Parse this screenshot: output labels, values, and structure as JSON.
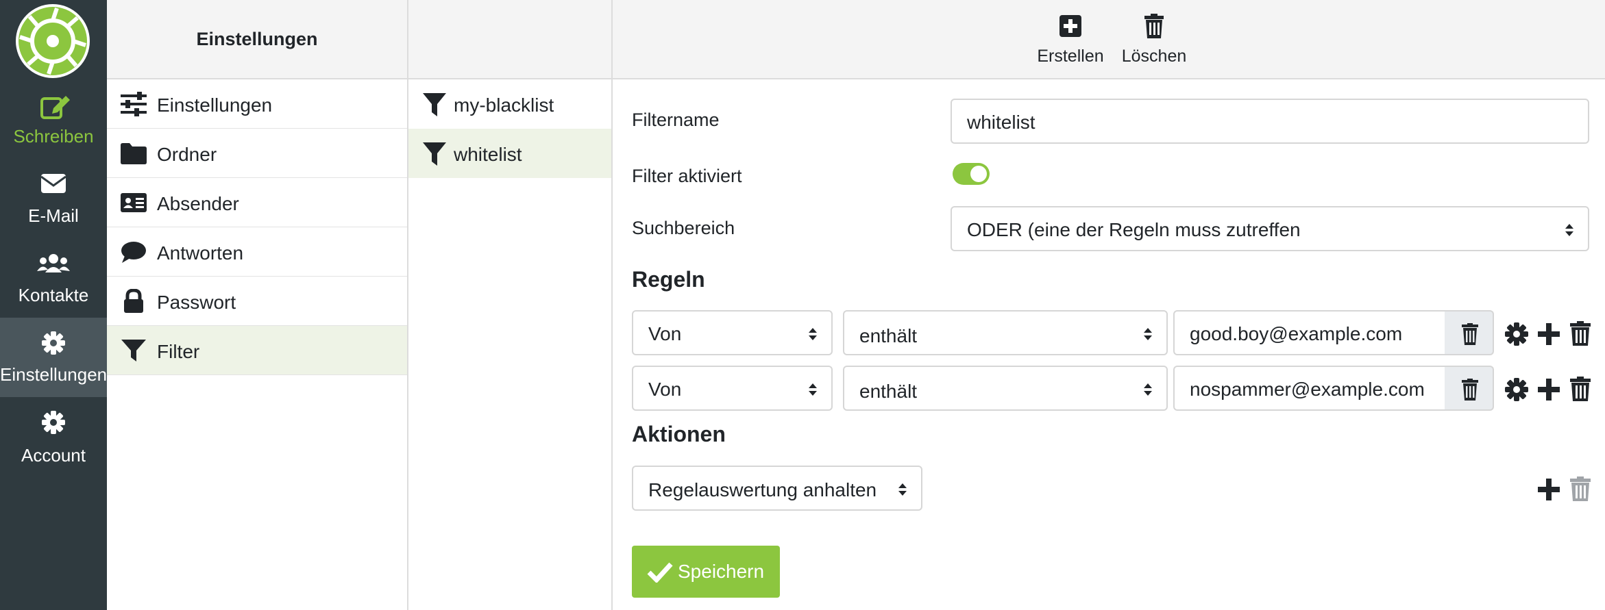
{
  "nav": {
    "items": [
      {
        "label": "Schreiben",
        "icon": "pencil-square-icon"
      },
      {
        "label": "E-Mail",
        "icon": "envelope-icon"
      },
      {
        "label": "Kontakte",
        "icon": "users-icon"
      },
      {
        "label": "Einstellungen",
        "icon": "gear-icon"
      },
      {
        "label": "Account",
        "icon": "gear-icon"
      }
    ],
    "active": "Einstellungen",
    "accent": "#8cc63f"
  },
  "settings": {
    "title": "Einstellungen",
    "items": [
      {
        "label": "Einstellungen",
        "icon": "sliders-icon"
      },
      {
        "label": "Ordner",
        "icon": "folder-icon"
      },
      {
        "label": "Absender",
        "icon": "id-card-icon"
      },
      {
        "label": "Antworten",
        "icon": "speech-bubble-icon"
      },
      {
        "label": "Passwort",
        "icon": "lock-icon"
      },
      {
        "label": "Filter",
        "icon": "filter-icon"
      }
    ],
    "selected": "Filter"
  },
  "filters": {
    "items": [
      {
        "label": "my-blacklist"
      },
      {
        "label": "whitelist"
      }
    ],
    "selected": "whitelist"
  },
  "toolbar": {
    "create_label": "Erstellen",
    "delete_label": "Löschen"
  },
  "form": {
    "name_label": "Filtername",
    "name_value": "whitelist",
    "enabled_label": "Filter aktiviert",
    "enabled": true,
    "scope_label": "Suchbereich",
    "scope_value": "ODER (eine der Regeln muss zutreffen",
    "rules_heading": "Regeln",
    "rules": [
      {
        "header": "Von",
        "op": "enthält",
        "value": "good.boy@example.com"
      },
      {
        "header": "Von",
        "op": "enthält",
        "value": "nospammer@example.com"
      }
    ],
    "actions_heading": "Aktionen",
    "action_value": "Regelauswertung anhalten",
    "save_label": "Speichern"
  }
}
